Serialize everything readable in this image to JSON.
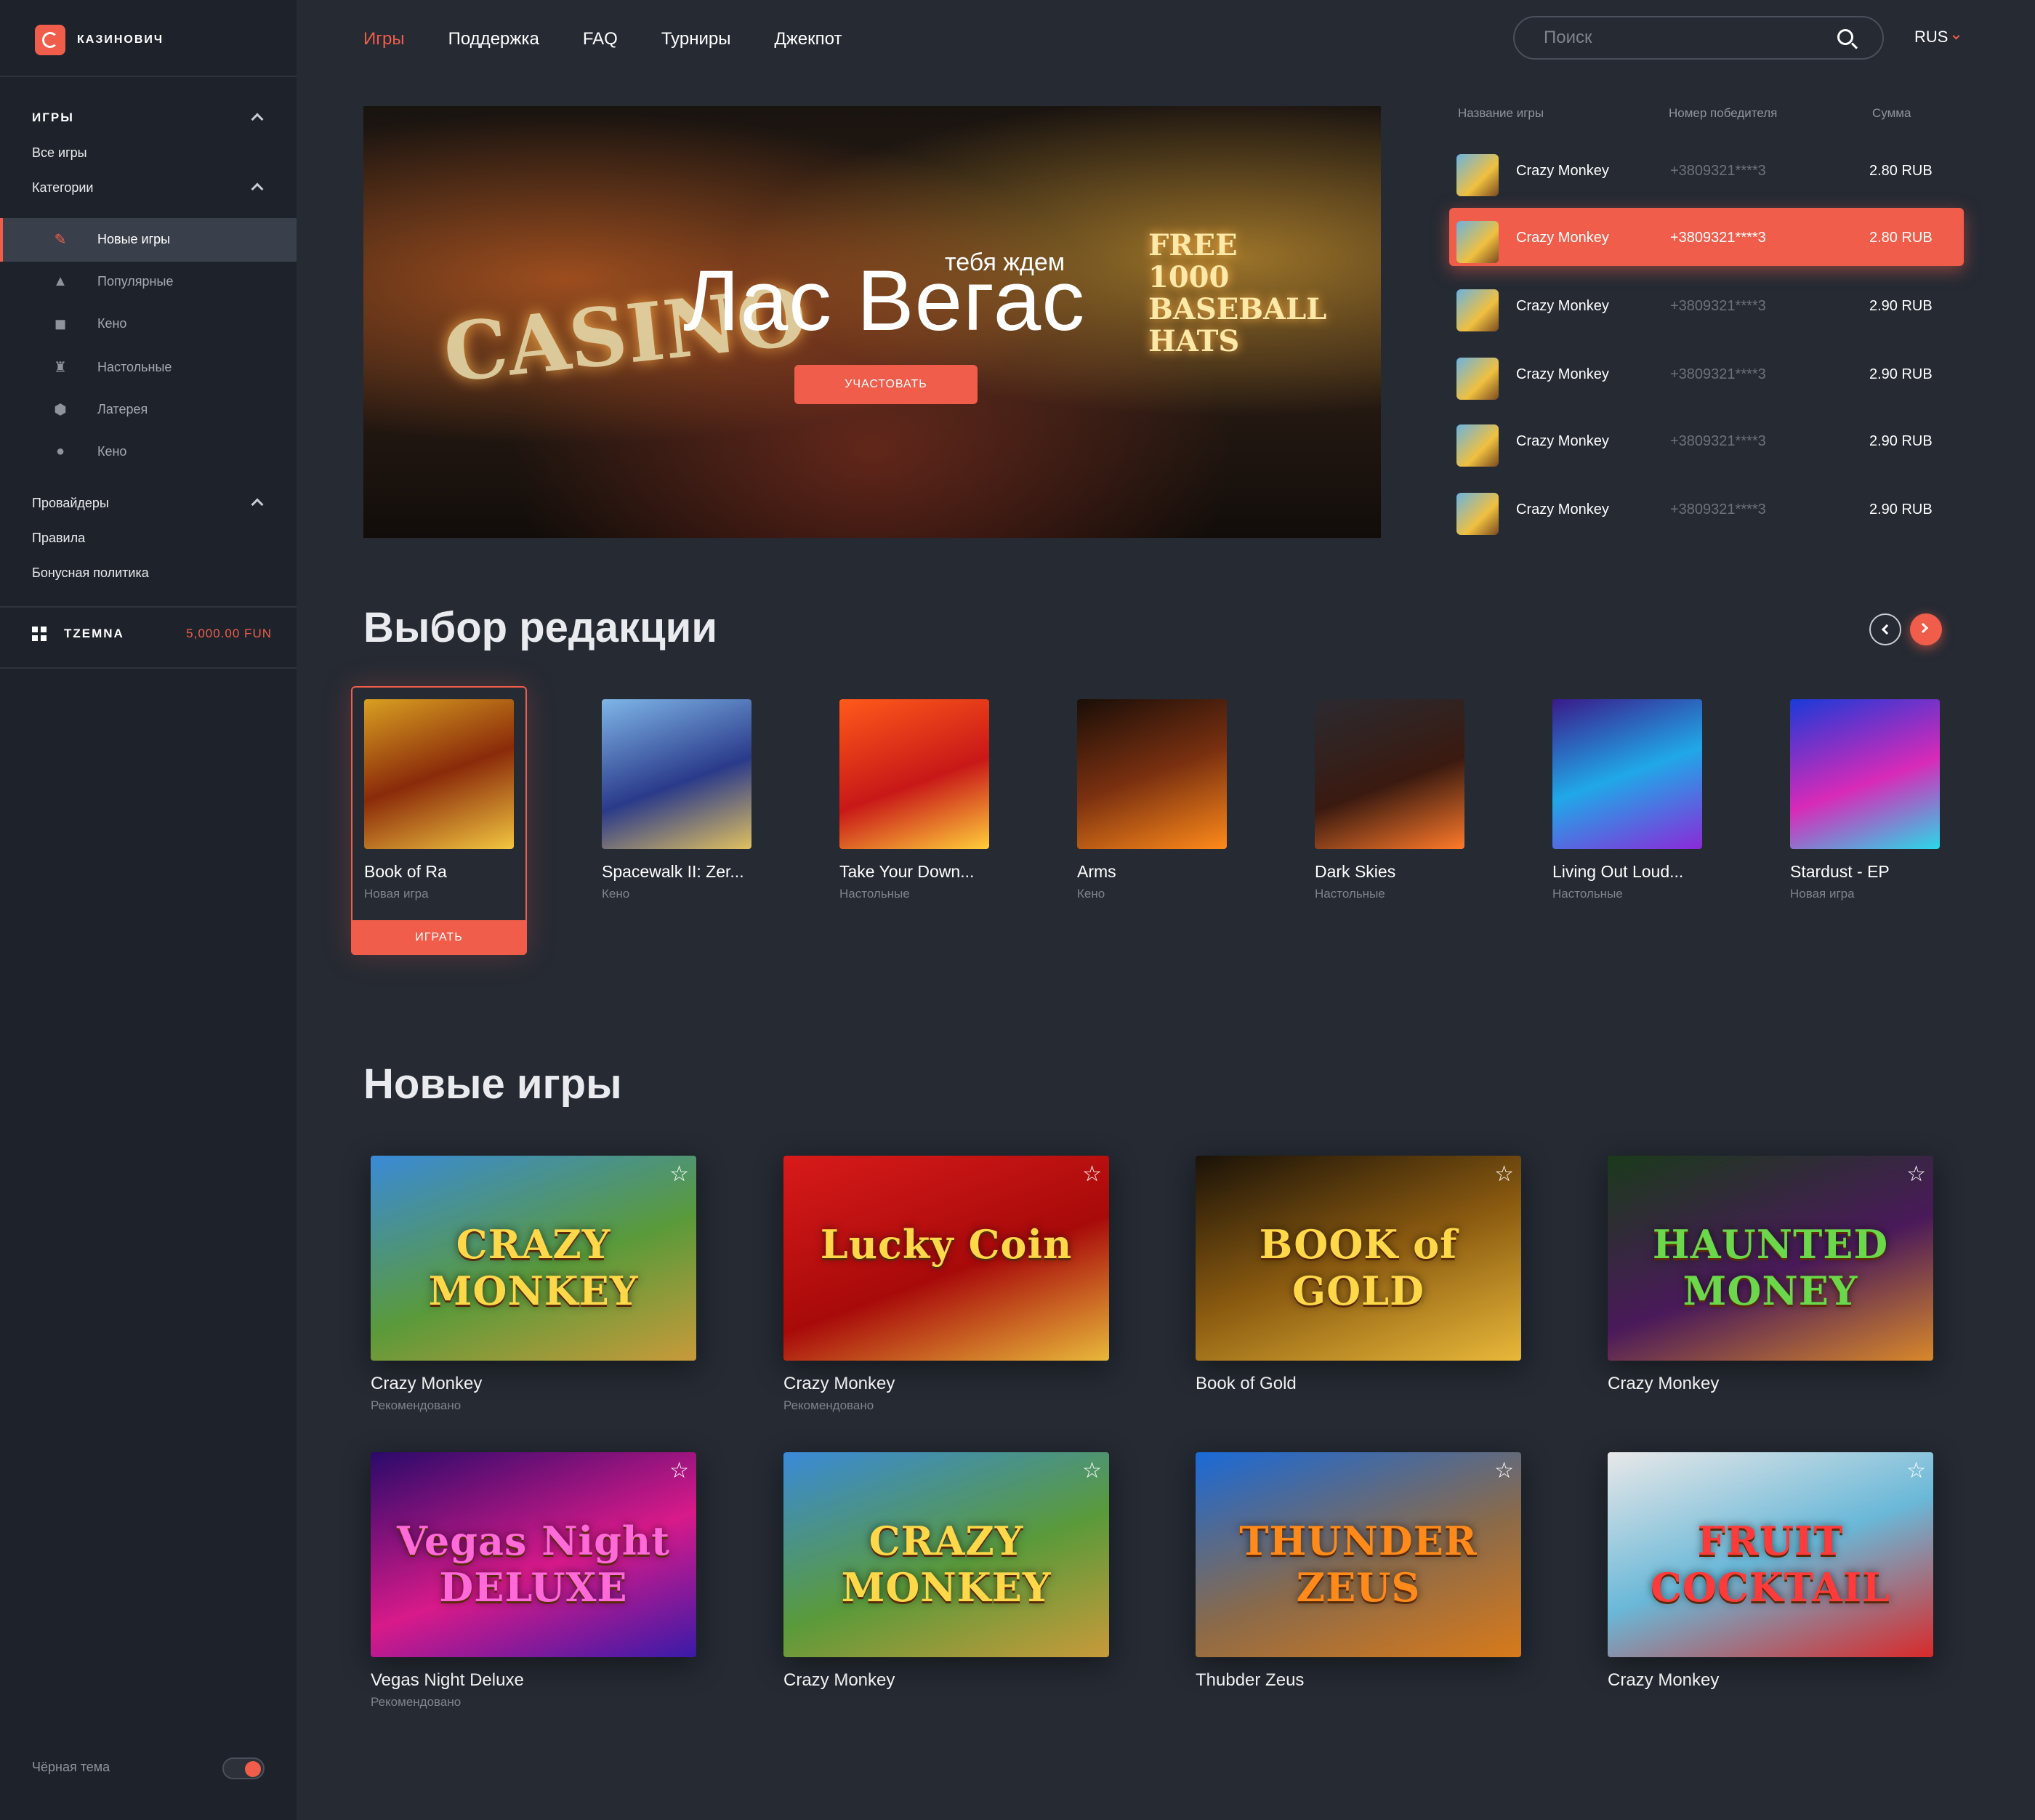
{
  "brand": {
    "name": "КАЗИНОВИЧ"
  },
  "sidebar": {
    "games_heading": "ИГРЫ",
    "all_games": "Все игры",
    "categories_label": "Категории",
    "categories": [
      {
        "label": "Новые игры",
        "icon": "wrench-icon"
      },
      {
        "label": "Популярные",
        "icon": "rocket-icon"
      },
      {
        "label": "Кено",
        "icon": "puzzle-icon"
      },
      {
        "label": "Настольные",
        "icon": "chess-rook-icon"
      },
      {
        "label": "Латерея",
        "icon": "dice-icon"
      },
      {
        "label": "Кено",
        "icon": "ball-icon"
      }
    ],
    "providers": "Провайдеры",
    "rules": "Правила",
    "bonus_policy": "Бонусная политика",
    "user": {
      "name": "TZEMNA",
      "balance": "5,000.00 FUN"
    },
    "theme_label": "Чёрная тема"
  },
  "nav": {
    "items": [
      "Игры",
      "Поддержка",
      "FAQ",
      "Турниры",
      "Джекпот"
    ],
    "active": "Игры"
  },
  "search": {
    "placeholder": "Поиск"
  },
  "lang": "RUS",
  "hero": {
    "subtitle": "тебя ждем",
    "title": "Лас Вегас",
    "button": "УЧАСТОВАТЬ",
    "neon_casino": "CASINO",
    "neon_sign": "FREE 1000 BASEBALL HATS"
  },
  "winners": {
    "headers": {
      "game": "Название игры",
      "phone": "Номер победителя",
      "sum": "Сумма"
    },
    "rows": [
      {
        "game": "Crazy Monkey",
        "phone": "+3809321****3",
        "sum": "2.80 RUB"
      },
      {
        "game": "Crazy Monkey",
        "phone": "+3809321****3",
        "sum": "2.80 RUB"
      },
      {
        "game": "Crazy Monkey",
        "phone": "+3809321****3",
        "sum": "2.90 RUB"
      },
      {
        "game": "Crazy Monkey",
        "phone": "+3809321****3",
        "sum": "2.90 RUB"
      },
      {
        "game": "Crazy Monkey",
        "phone": "+3809321****3",
        "sum": "2.90 RUB"
      },
      {
        "game": "Crazy Monkey",
        "phone": "+3809321****3",
        "sum": "2.90 RUB"
      }
    ]
  },
  "editors": {
    "title": "Выбор редакции",
    "play_label": "ИГРАТЬ",
    "items": [
      {
        "name": "Book of Ra",
        "category": "Новая игра"
      },
      {
        "name": "Spacewalk II: Zer...",
        "category": "Кено"
      },
      {
        "name": "Take Your Down...",
        "category": "Настольные"
      },
      {
        "name": "Arms",
        "category": "Кено"
      },
      {
        "name": "Dark Skies",
        "category": "Настольные"
      },
      {
        "name": "Living Out Loud...",
        "category": "Настольные"
      },
      {
        "name": "Stardust - EP",
        "category": "Новая игра"
      }
    ]
  },
  "new_games": {
    "title": "Новые игры",
    "items": [
      {
        "name": "Crazy Monkey",
        "category": "Рекомендовано",
        "art": "CRAZY MONKEY"
      },
      {
        "name": "Crazy Monkey",
        "category": "Рекомендовано",
        "art": "Lucky Coin"
      },
      {
        "name": "Book of Gold",
        "category": "",
        "art": "BOOK of GOLD"
      },
      {
        "name": "Crazy Monkey",
        "category": "",
        "art": "HAUNTED MONEY"
      },
      {
        "name": "Vegas Night Deluxe",
        "category": "Рекомендовано",
        "art": "Vegas Night DELUXE"
      },
      {
        "name": "Crazy Monkey",
        "category": "",
        "art": "CRAZY MONKEY"
      },
      {
        "name": "Thubder Zeus",
        "category": "",
        "art": "THUNDER ZEUS"
      },
      {
        "name": "Crazy Monkey",
        "category": "",
        "art": "FRUIT COCKTAIL"
      }
    ]
  },
  "colors": {
    "accent": "#f05d4a",
    "background": "#252a33",
    "sidebar": "#1e232b"
  }
}
